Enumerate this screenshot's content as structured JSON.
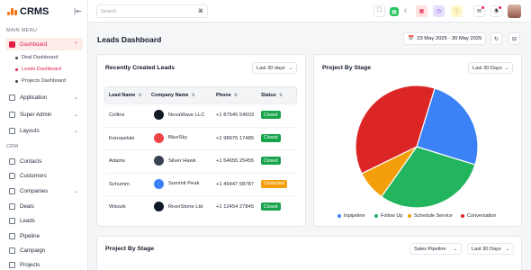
{
  "app": {
    "name": "CRMS"
  },
  "sidebar": {
    "main_menu_label": "MAIN MENU",
    "crm_label": "CRM",
    "items": [
      {
        "label": "Dashboard"
      },
      {
        "label": "Application"
      },
      {
        "label": "Super Admin"
      },
      {
        "label": "Layouts"
      },
      {
        "label": "Contacts"
      },
      {
        "label": "Customers"
      },
      {
        "label": "Companies"
      },
      {
        "label": "Deals"
      },
      {
        "label": "Leads"
      },
      {
        "label": "Pipeline"
      },
      {
        "label": "Campaign"
      },
      {
        "label": "Projects"
      }
    ],
    "subitems": [
      {
        "label": "Deal Dashboard"
      },
      {
        "label": "Leads Dashboard"
      },
      {
        "label": "Projects Dashboard"
      }
    ]
  },
  "topbar": {
    "search_placeholder": "Search",
    "search_shortcut": "⌘"
  },
  "page": {
    "title": "Leads Dashboard",
    "date_range": "23 May 2025 - 30 May 2025"
  },
  "recent_leads": {
    "title": "Recently Created Leads",
    "filter": "Last 30 days",
    "columns": [
      "Lead Name",
      "Company Name",
      "Phone",
      "Status"
    ],
    "rows": [
      {
        "lead": "Collins",
        "company": "NovaWave LLC",
        "phone": "+1 87545 54503",
        "status": "Closed",
        "status_color": "#16a34a",
        "logo_color": "#111827"
      },
      {
        "lead": "Konopelski",
        "company": "BlueSky",
        "phone": "+1 98975 17485",
        "status": "Closed",
        "status_color": "#16a34a",
        "logo_color": "#ef4444"
      },
      {
        "lead": "Adams",
        "company": "Silver Hawk",
        "phone": "+1 54655 25455",
        "status": "Closed",
        "status_color": "#16a34a",
        "logo_color": "#374151"
      },
      {
        "lead": "Schumm",
        "company": "Summit Peak",
        "phone": "+1 45447 58787",
        "status": "Contacted",
        "status_color": "#f59e0b",
        "logo_color": "#3b82f6"
      },
      {
        "lead": "Wisozk",
        "company": "RiverStone Ltd",
        "phone": "+1 12454 27845",
        "status": "Closed",
        "status_color": "#16a34a",
        "logo_color": "#111827"
      }
    ]
  },
  "project_stage_card": {
    "title": "Project By Stage",
    "filter": "Last 30 Days"
  },
  "chart_data": {
    "type": "pie",
    "title": "Project By Stage",
    "categories": [
      "Inpipeline",
      "Follow Up",
      "Schedule Service",
      "Conversation"
    ],
    "values": [
      25,
      30,
      8,
      37
    ],
    "colors": [
      "#3b82f6",
      "#22b55e",
      "#f59e0b",
      "#dc2626"
    ],
    "legend_position": "bottom"
  },
  "bottom_card": {
    "title": "Project By Stage",
    "pipeline_filter": "Sales Pipeline",
    "period_filter": "Last 30 Days"
  }
}
